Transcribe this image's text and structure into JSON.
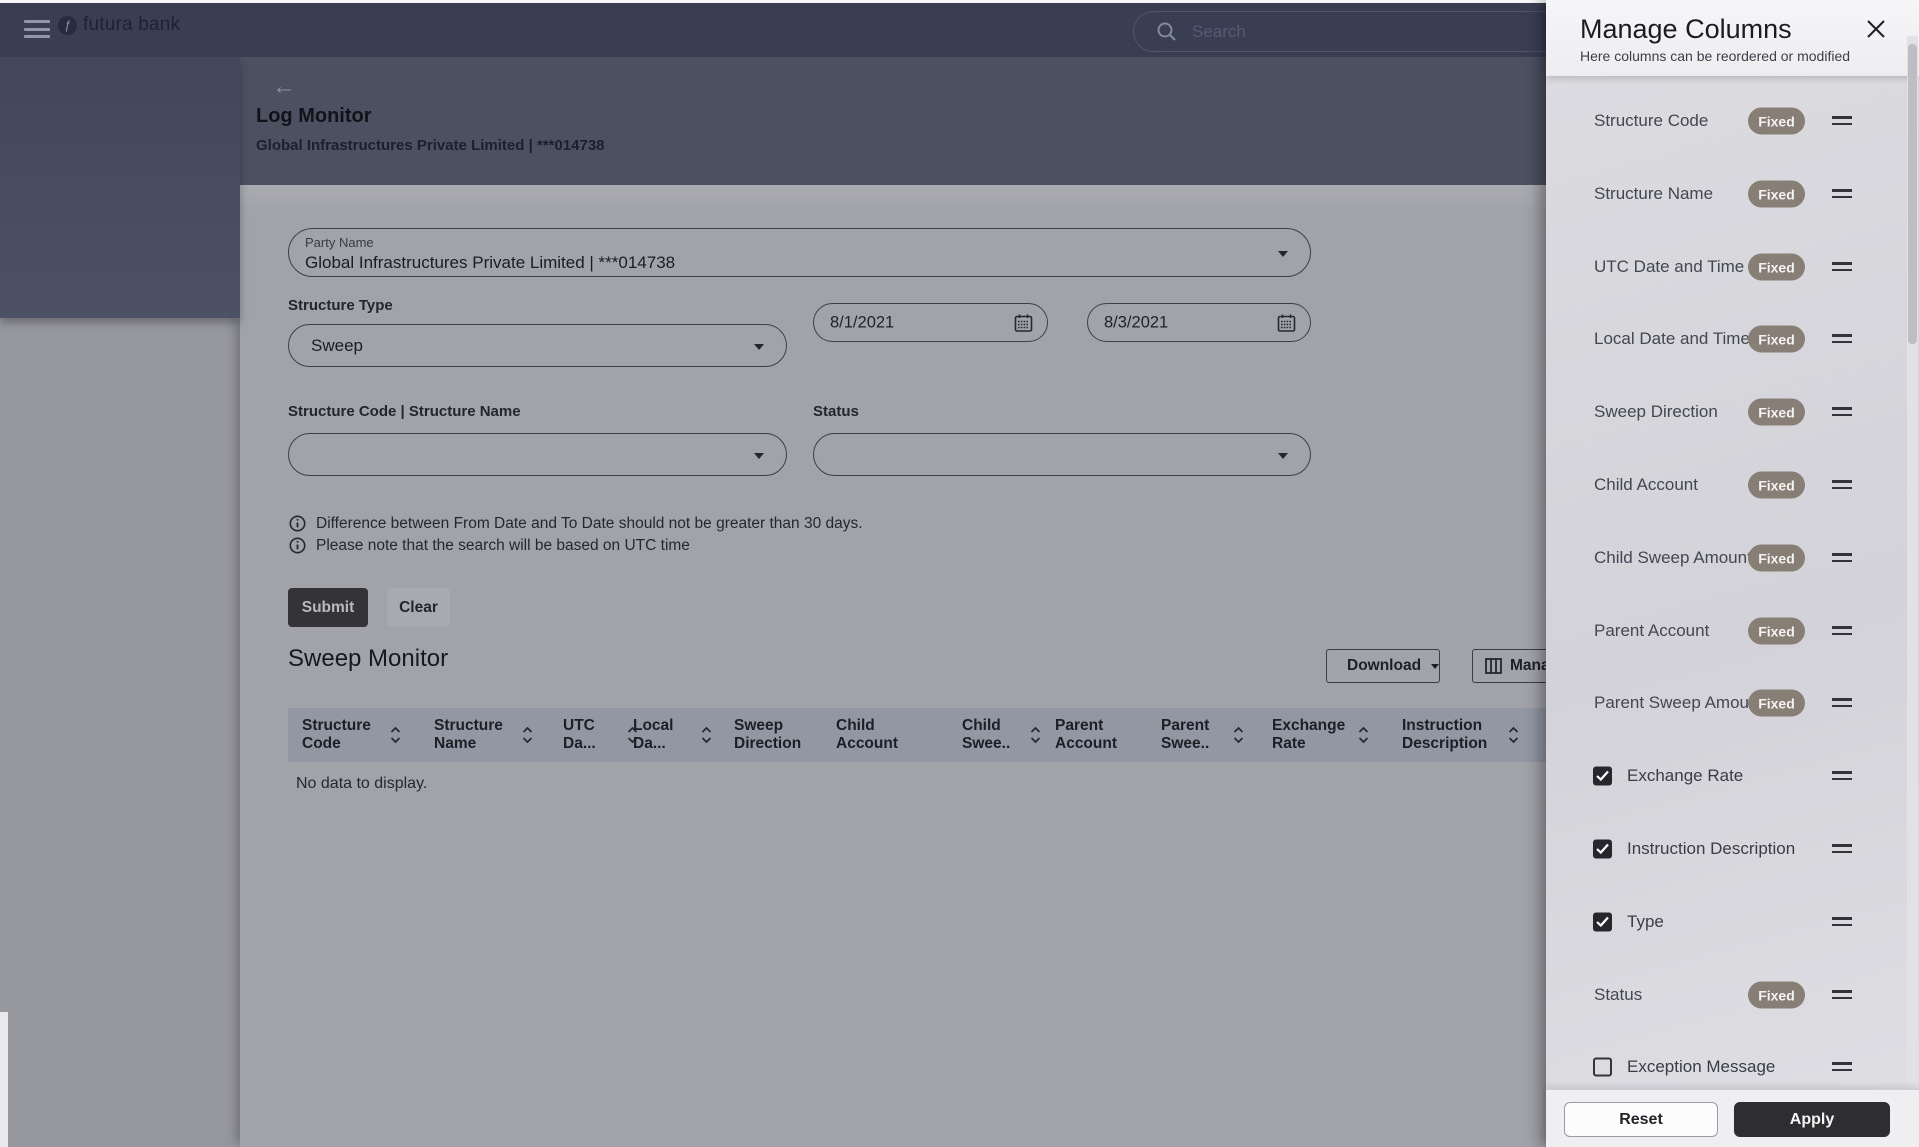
{
  "topbar": {
    "brand": "futura bank",
    "search_placeholder": "Search"
  },
  "page_header": {
    "title": "Log Monitor",
    "subtitle": "Global Infrastructures Private Limited | ***014738",
    "back_arrow": "←"
  },
  "filters": {
    "party_name": {
      "label": "Party Name",
      "value": "Global Infrastructures  Private Limited | ***014738"
    },
    "structure_type": {
      "label": "Structure Type",
      "value": "Sweep"
    },
    "from_date": "8/1/2021",
    "to_date": "8/3/2021",
    "structure_code_name": {
      "label": "Structure Code | Structure Name",
      "value": ""
    },
    "status": {
      "label": "Status",
      "value": ""
    },
    "notes": [
      "Difference between From Date and To Date should not be greater than 30 days.",
      "Please note that the search will be based on UTC time"
    ],
    "submit_label": "Submit",
    "clear_label": "Clear"
  },
  "results": {
    "title": "Sweep Monitor",
    "download_label": "Download",
    "manage_label": "Manage",
    "empty_message": "No data to display.",
    "columns": [
      {
        "label": "Structure Code",
        "sortable": true
      },
      {
        "label": "Structure Name",
        "sortable": true
      },
      {
        "label": "UTC Da...",
        "sortable": true
      },
      {
        "label": "Local Da...",
        "sortable": true
      },
      {
        "label": "Sweep Direction",
        "sortable": false
      },
      {
        "label": "Child Account",
        "sortable": false
      },
      {
        "label": "Child Swee..",
        "sortable": true
      },
      {
        "label": "Parent Account",
        "sortable": false
      },
      {
        "label": "Parent Swee..",
        "sortable": true
      },
      {
        "label": "Exchange Rate",
        "sortable": true
      },
      {
        "label": "Instruction Description",
        "sortable": true
      }
    ]
  },
  "manage_columns_panel": {
    "title": "Manage Columns",
    "subtitle": "Here columns can be reordered or modified",
    "fixed_badge_label": "Fixed",
    "reset_label": "Reset",
    "apply_label": "Apply",
    "items": [
      {
        "label": "Structure Code",
        "type": "fixed"
      },
      {
        "label": "Structure Name",
        "type": "fixed"
      },
      {
        "label": "UTC Date and Time",
        "type": "fixed"
      },
      {
        "label": "Local Date and Time",
        "type": "fixed"
      },
      {
        "label": "Sweep Direction",
        "type": "fixed"
      },
      {
        "label": "Child Account",
        "type": "fixed"
      },
      {
        "label": "Child Sweep Amount",
        "type": "fixed"
      },
      {
        "label": "Parent Account",
        "type": "fixed"
      },
      {
        "label": "Parent Sweep Amount",
        "type": "fixed"
      },
      {
        "label": "Exchange Rate",
        "type": "checkbox",
        "checked": true
      },
      {
        "label": "Instruction Description",
        "type": "checkbox",
        "checked": true
      },
      {
        "label": "Type",
        "type": "checkbox",
        "checked": true
      },
      {
        "label": "Status",
        "type": "fixed"
      },
      {
        "label": "Exception Message",
        "type": "checkbox",
        "checked": false
      }
    ]
  },
  "colors": {
    "topbar": "#3a3e52",
    "banner": "#4c5061",
    "card_dimmed": "#a2a3a9",
    "table_header": "#9297a3",
    "fixed_badge": "#877f76",
    "apply_button": "#2e2d30"
  }
}
